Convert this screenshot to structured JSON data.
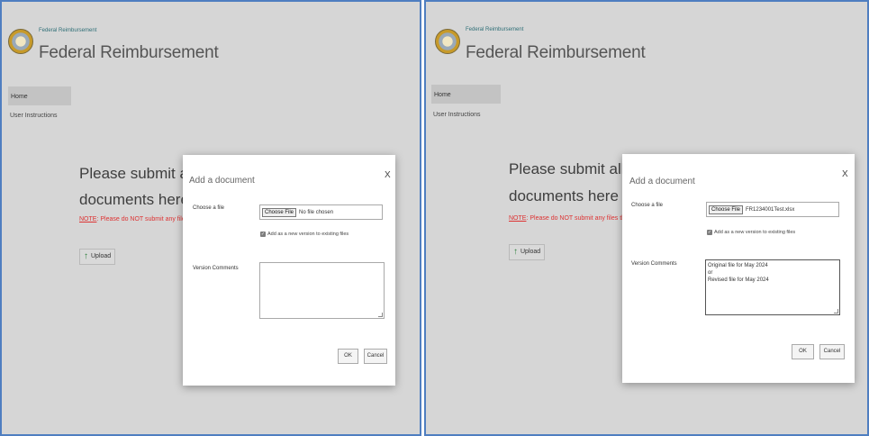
{
  "left": {
    "site_small_title": "Federal Reimbursement",
    "site_title": "Federal Reimbursement",
    "nav": {
      "home": "Home",
      "user_instructions": "User Instructions"
    },
    "main": {
      "heading_line1": "Please submit all Fede",
      "heading_line2": "documents here",
      "note_prefix": "NOTE",
      "note_text": ": Please do NOT submit any files th",
      "upload_label": "Upload"
    },
    "dialog": {
      "title": "Add a document",
      "close": "X",
      "choose_file_label": "Choose a file",
      "choose_button": "Choose File",
      "file_status": "No file chosen",
      "checkbox_label": "Add as a new version to existing files",
      "version_comments_label": "Version Comments",
      "version_comments_lines": [
        "",
        "",
        ""
      ],
      "ok": "OK",
      "cancel": "Cancel"
    }
  },
  "right": {
    "site_small_title": "Federal Reimbursement",
    "site_title": "Federal Reimbursement",
    "nav": {
      "home": "Home",
      "user_instructions": "User Instructions"
    },
    "main": {
      "heading_line1": "Please submit all Fede",
      "heading_line2": "documents here",
      "note_prefix": "NOTE",
      "note_text": ": Please do NOT submit any files th",
      "upload_label": "Upload"
    },
    "dialog": {
      "title": "Add a document",
      "close": "X",
      "choose_file_label": "Choose a file",
      "choose_button": "Choose File",
      "file_status": "FR1234001Test.xlsx",
      "checkbox_label": "Add as a new version to existing files",
      "version_comments_label": "Version Comments",
      "version_comments_lines": [
        "Original file for May 2024",
        "or",
        "Revised file for May 2024"
      ],
      "ok": "OK",
      "cancel": "Cancel"
    }
  },
  "icons": {
    "logo": "state-seal-logo",
    "upload": "upload-arrow-icon",
    "checkbox": "checkbox-checked-icon"
  },
  "colors": {
    "panel_border": "#4f7ec0",
    "note_red": "#dd3333",
    "upload_green": "#2d7f3c"
  }
}
